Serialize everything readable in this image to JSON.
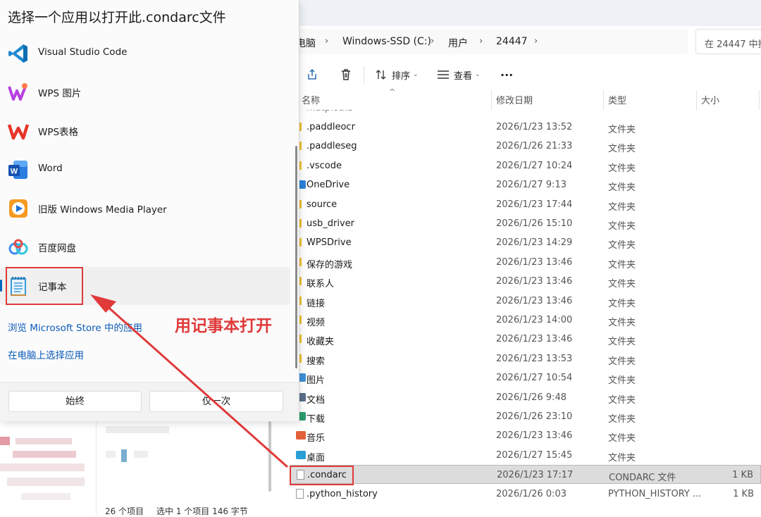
{
  "dialog": {
    "title": "选择一个应用以打开此.condarc文件",
    "apps": [
      {
        "label": "Visual Studio Code",
        "icon": "vscode-icon"
      },
      {
        "label": "WPS 图片",
        "icon": "wps-picture-icon"
      },
      {
        "label": "WPS表格",
        "icon": "wps-sheet-icon"
      },
      {
        "label": "Word",
        "icon": "word-icon"
      },
      {
        "label": "旧版 Windows Media Player",
        "icon": "media-player-icon"
      },
      {
        "label": "百度网盘",
        "icon": "baidu-netdisk-icon"
      },
      {
        "label": "记事本",
        "icon": "notepad-icon",
        "selected": true
      }
    ],
    "store_link": "浏览 Microsoft Store 中的应用",
    "choose_link": "在电脑上选择应用",
    "always_button": "始终",
    "once_button": "仅一次"
  },
  "annotation": {
    "text": "用记事本打开",
    "color": "#e03a3a"
  },
  "explorer": {
    "breadcrumb": [
      "电脑",
      "Windows-SSD (C:)",
      "用户",
      "24447"
    ],
    "search_placeholder": "在 24447 中搜",
    "toolbar": {
      "sort_label": "排序",
      "view_label": "查看",
      "more_label": "..."
    },
    "columns": {
      "name": "名称",
      "date": "修改日期",
      "type": "类型",
      "size": "大小"
    },
    "files": [
      {
        "name": ".paddleocr",
        "date": "2026/1/23 13:52",
        "type": "文件夹",
        "size": "",
        "icon": "folder-icon"
      },
      {
        "name": ".paddleseg",
        "date": "2026/1/26 21:33",
        "type": "文件夹",
        "size": "",
        "icon": "folder-icon"
      },
      {
        "name": ".vscode",
        "date": "2026/1/27 10:24",
        "type": "文件夹",
        "size": "",
        "icon": "folder-icon"
      },
      {
        "name": "OneDrive",
        "date": "2026/1/27 9:13",
        "type": "文件夹",
        "size": "",
        "icon": "onedrive-icon"
      },
      {
        "name": "source",
        "date": "2026/1/23 17:44",
        "type": "文件夹",
        "size": "",
        "icon": "folder-icon"
      },
      {
        "name": "usb_driver",
        "date": "2026/1/26 15:10",
        "type": "文件夹",
        "size": "",
        "icon": "folder-icon"
      },
      {
        "name": "WPSDrive",
        "date": "2026/1/23 14:29",
        "type": "文件夹",
        "size": "",
        "icon": "folder-icon"
      },
      {
        "name": "保存的游戏",
        "date": "2026/1/23 13:46",
        "type": "文件夹",
        "size": "",
        "icon": "folder-icon"
      },
      {
        "name": "联系人",
        "date": "2026/1/23 13:46",
        "type": "文件夹",
        "size": "",
        "icon": "folder-icon"
      },
      {
        "name": "链接",
        "date": "2026/1/23 13:46",
        "type": "文件夹",
        "size": "",
        "icon": "folder-icon"
      },
      {
        "name": "视频",
        "date": "2026/1/23 14:00",
        "type": "文件夹",
        "size": "",
        "icon": "folder-icon"
      },
      {
        "name": "收藏夹",
        "date": "2026/1/23 13:46",
        "type": "文件夹",
        "size": "",
        "icon": "folder-icon"
      },
      {
        "name": "搜索",
        "date": "2026/1/23 13:53",
        "type": "文件夹",
        "size": "",
        "icon": "folder-icon"
      },
      {
        "name": "图片",
        "date": "2026/1/27 10:54",
        "type": "文件夹",
        "size": "",
        "icon": "pictures-folder-icon"
      },
      {
        "name": "文档",
        "date": "2026/1/26 9:48",
        "type": "文件夹",
        "size": "",
        "icon": "documents-folder-icon"
      },
      {
        "name": "下载",
        "date": "2026/1/26 23:10",
        "type": "文件夹",
        "size": "",
        "icon": "downloads-folder-icon"
      },
      {
        "name": "音乐",
        "date": "2026/1/23 13:46",
        "type": "文件夹",
        "size": "",
        "icon": "music-folder-icon"
      },
      {
        "name": "桌面",
        "date": "2026/1/27 15:45",
        "type": "文件夹",
        "size": "",
        "icon": "desktop-folder-icon"
      },
      {
        "name": ".condarc",
        "date": "2026/1/23 17:17",
        "type": "CONDARC 文件",
        "size": "1 KB",
        "icon": "file-icon",
        "selected": true
      },
      {
        "name": ".python_history",
        "date": "2026/1/26 0:03",
        "type": "PYTHON_HISTORY ...",
        "size": "1 KB",
        "icon": "file-icon"
      }
    ],
    "status": {
      "count": "26 个项目",
      "selection": "选中 1 个项目  146 字节"
    }
  }
}
